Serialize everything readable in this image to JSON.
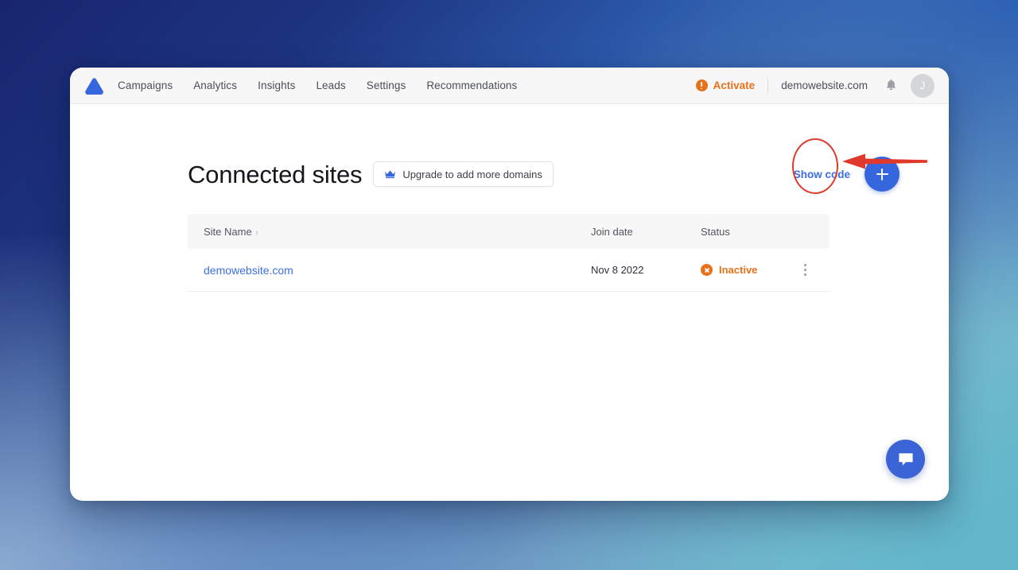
{
  "app": {
    "logo_icon": "triangle-logo-icon"
  },
  "nav": {
    "items": [
      {
        "label": "Campaigns"
      },
      {
        "label": "Analytics"
      },
      {
        "label": "Insights"
      },
      {
        "label": "Leads"
      },
      {
        "label": "Settings"
      },
      {
        "label": "Recommendations"
      }
    ]
  },
  "topbar_right": {
    "activate_label": "Activate",
    "activate_icon": "warning-circle-icon",
    "site_name": "demowebsite.com",
    "bell_icon": "bell-icon",
    "avatar_initial": "J"
  },
  "page": {
    "title": "Connected sites",
    "upgrade_label": "Upgrade to add more domains",
    "upgrade_icon": "crown-icon",
    "show_code_label": "Show code",
    "add_button_icon": "plus-icon"
  },
  "table": {
    "columns": {
      "site_name": "Site Name",
      "sort_arrow": "↑",
      "join_date": "Join date",
      "status": "Status"
    },
    "rows": [
      {
        "site_name": "demowebsite.com",
        "join_date": "Nov 8 2022",
        "status": "Inactive",
        "status_icon": "x-circle-icon"
      }
    ]
  },
  "chat": {
    "icon": "chat-bubble-icon"
  },
  "annotations": {
    "highlight_shape": "red-ellipse-around-add-button",
    "pointer_shape": "red-arrow-pointing-left"
  },
  "colors": {
    "brand_blue": "#3566dd",
    "link_blue": "#3b6fe0",
    "warning_orange": "#e8711a",
    "annotation_red": "#e0392c",
    "surface": "#ffffff",
    "header_bg": "#f7f7f8"
  }
}
